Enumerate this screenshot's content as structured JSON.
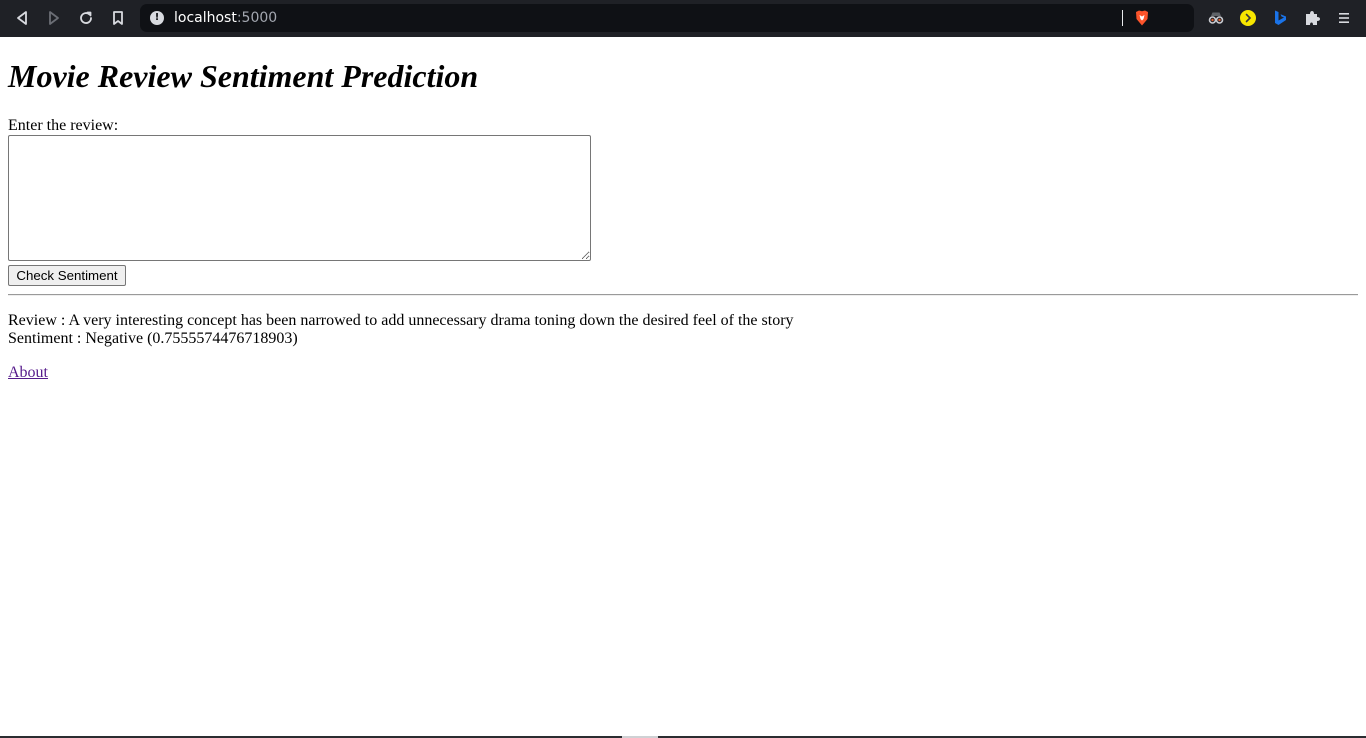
{
  "browser": {
    "url_host": "localhost",
    "url_port": ":5000",
    "extension_icons": [
      "incognito-glasses-icon",
      "yellow-circle-extension-icon",
      "blue-b-extension-icon",
      "puzzle-extensions-icon",
      "menu-icon"
    ]
  },
  "page": {
    "title": "Movie Review Sentiment Prediction",
    "review_label": "Enter the review:",
    "review_text": "",
    "submit_label": "Check Sentiment",
    "result": {
      "review_line": "Review : A very interesting concept has been narrowed to add unnecessary drama toning down the desired feel of the story",
      "sentiment_line": "Sentiment : Negative (0.7555574476718903)"
    },
    "about_link": "About"
  },
  "colors": {
    "browser_bar": "#1f2126",
    "url_bar": "#0f1115",
    "visited_link": "#551a8b",
    "brave_orange": "#fb542b",
    "extension_yellow": "#f7e600",
    "extension_blue": "#1a73e8"
  }
}
